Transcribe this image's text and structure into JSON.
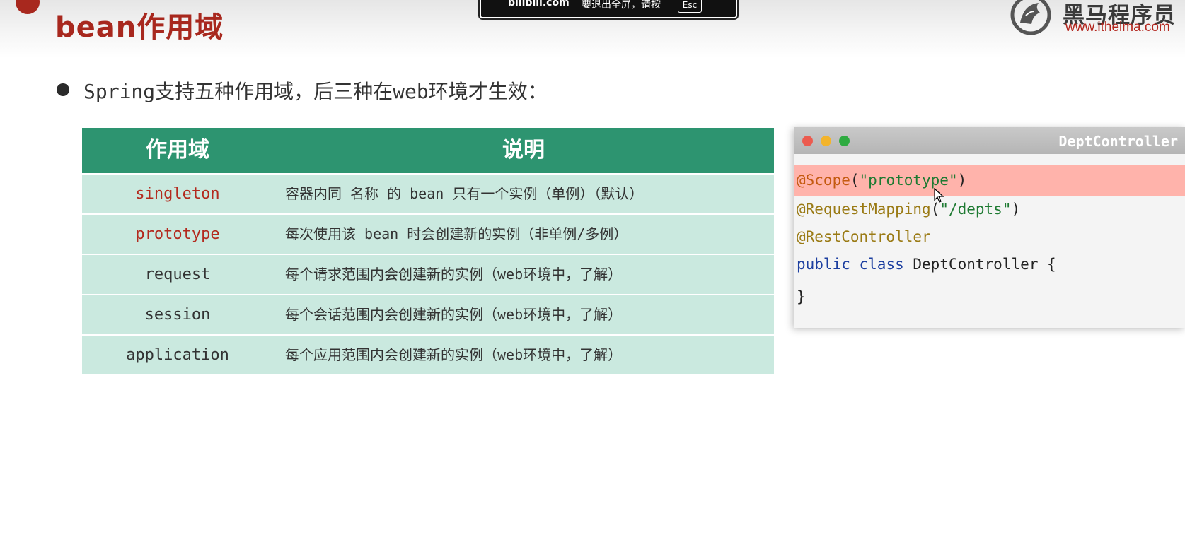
{
  "header": {
    "title": "bean作用域"
  },
  "toast": {
    "site": "bilibili.com",
    "message": "要退出全屏，请按",
    "key": "Esc"
  },
  "logo": {
    "name": "黑马程序员",
    "url": "www.itheima.com"
  },
  "bullet": {
    "text": "Spring支持五种作用域，后三种在web环境才生效："
  },
  "table": {
    "headers": [
      "作用域",
      "说明"
    ],
    "rows": [
      {
        "scope": "singleton",
        "desc": "容器内同 名称 的 bean 只有一个实例（单例）（默认）",
        "highlight": true
      },
      {
        "scope": "prototype",
        "desc": "每次使用该 bean 时会创建新的实例（非单例/多例）",
        "highlight": true
      },
      {
        "scope": "request",
        "desc": "每个请求范围内会创建新的实例（web环境中，了解）",
        "highlight": false
      },
      {
        "scope": "session",
        "desc": "每个会话范围内会创建新的实例（web环境中，了解）",
        "highlight": false
      },
      {
        "scope": "application",
        "desc": "每个应用范围内会创建新的实例（web环境中，了解）",
        "highlight": false
      }
    ]
  },
  "code": {
    "window_title": "DeptController",
    "line1": {
      "annotation": "@Scope",
      "open": "(",
      "string": "\"prototype\"",
      "close": ")"
    },
    "line2": {
      "annotation": "@RequestMapping",
      "open": "(",
      "string": "\"/depts\"",
      "close": ")"
    },
    "line3": {
      "annotation": "@RestController"
    },
    "line4": {
      "kw1": "public",
      "kw2": "class",
      "rest": "DeptController {"
    },
    "line5": {
      "text": "}"
    }
  },
  "colors": {
    "accent_red": "#a8281e",
    "table_header": "#2d9470",
    "table_row": "#cae9df",
    "code_highlight": "#ffb3ab"
  }
}
